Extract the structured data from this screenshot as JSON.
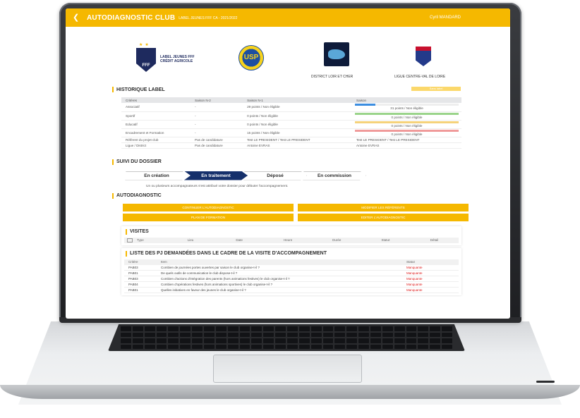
{
  "topbar": {
    "title": "AUTODIAGNOSTIC CLUB",
    "subtitle": "LABEL JEUNES FFF CA - 2021/2022",
    "user": "Cyril MANDARD",
    "accent": "#f5b800"
  },
  "logos": {
    "fff_text": "LABEL JEUNES FFF CRÉDIT AGRICOLE",
    "fff_text_line1": "LABEL JEUNES FFF",
    "fff_text_line2": "CRÉDIT AGRICOLE",
    "usp": "USP",
    "district": "DISTRICT LOIR ET CHER",
    "ligue": "LIGUE CENTRE-VAL DE LOIRE"
  },
  "historique": {
    "title": "HISTORIQUE LABEL",
    "badge": "Sans label",
    "columns": [
      "Critères",
      "Saison N-2",
      "Saison N-1",
      "Saison"
    ],
    "rows": [
      {
        "critere": "Associatif",
        "n2": "-",
        "n1": "29 points / Non éligible",
        "saison": "31 points / Non éligible",
        "bar_color": "#3b8de0",
        "fill": 0.2
      },
      {
        "critere": "Sportif",
        "n2": "-",
        "n1": "0 points / Non éligible",
        "saison": "0 points / Non éligible",
        "bar_color": "#9ad48a",
        "fill": 1
      },
      {
        "critere": "Educatif",
        "n2": "-",
        "n1": "0 points / Non éligible",
        "saison": "0 points / Non éligible",
        "bar_color": "#f5d27a",
        "fill": 1
      },
      {
        "critere": "Encadrement et Formation",
        "n2": "-",
        "n1": "15 points / Non éligible",
        "saison": "0 points / Non éligible",
        "bar_color": "#f09a9a",
        "fill": 1
      }
    ],
    "extra_rows": [
      {
        "critere": "Référent du projet club",
        "n2": "Pas de candidature",
        "n1": "Test LE PRESIDENT / Test LE PRESIDENT",
        "saison": "Test LE PRESIDENT / Test LE PRESIDENT"
      },
      {
        "critere": "Ligue / District",
        "n2": "Pas de candidature",
        "n1": "Antoine EVRAS",
        "saison": "Antoine EVRAS"
      }
    ]
  },
  "suivi": {
    "title": "SUIVI DU DOSSIER",
    "steps": [
      "En création",
      "En traitement",
      "Déposé",
      "En commission"
    ],
    "active_step": "En traitement",
    "hint": "Un ou plusieurs accompagnateurs s'est attribué votre dossier pour débuter l'accompagnement."
  },
  "autodiagnostic": {
    "title": "AUTODIAGNOSTIC",
    "buttons": [
      "CONTINUER L'AUTODIAGNOSTIC",
      "MODIFIER LES RÉFÉRENTS",
      "PLAN DE FORMATION",
      "EDITER L'AUTODIAGNOSTIC"
    ]
  },
  "visites": {
    "title": "VISITES",
    "columns": [
      "Type",
      "Lieu",
      "Date",
      "Heure",
      "Durée",
      "Statut",
      "Détail"
    ]
  },
  "pj": {
    "title": "LISTE DES PJ DEMANDÉES DANS LE CADRE DE LA VISITE D'ACCOMPAGNEMENT",
    "columns": [
      "Critère",
      "Item",
      "Statut"
    ],
    "rows": [
      {
        "critere": "PAB03",
        "item": "Combien de journées portes ouvertes par saison le club organise-t-il ?",
        "statut": "Manquante"
      },
      {
        "critere": "PAB01",
        "item": "De quels outils de communication le club dispose-t-il ?",
        "statut": "Manquante"
      },
      {
        "critere": "PAB03",
        "item": "Combien d'actions d'intégration des parents (hors animations festives) le club organise-t-il ?",
        "statut": "Manquante"
      },
      {
        "critere": "PAB04",
        "item": "Combien d'opérations festives (hors animations sportives) le club organise-t-il ?",
        "statut": "Manquante"
      },
      {
        "critere": "PAB01",
        "item": "Quelles initiatives en faveur des jeunes le club organise-t-il ?",
        "statut": "Manquante"
      }
    ]
  }
}
